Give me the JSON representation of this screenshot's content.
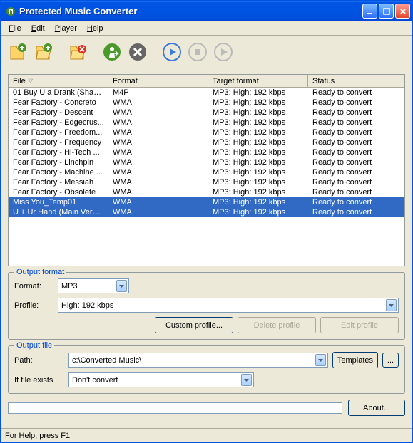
{
  "window": {
    "title": "Protected Music Converter"
  },
  "menu": {
    "file": "File",
    "edit": "Edit",
    "player": "Player",
    "help": "Help"
  },
  "columns": {
    "file": "File",
    "format": "Format",
    "target": "Target format",
    "status": "Status"
  },
  "rows": [
    {
      "file": "01 Buy U a Drank (Shaw...",
      "format": "M4P",
      "target": "MP3: High: 192 kbps",
      "status": "Ready to convert",
      "selected": false
    },
    {
      "file": "Fear Factory - Concreto",
      "format": "WMA",
      "target": "MP3: High: 192 kbps",
      "status": "Ready to convert",
      "selected": false
    },
    {
      "file": "Fear Factory - Descent",
      "format": "WMA",
      "target": "MP3: High: 192 kbps",
      "status": "Ready to convert",
      "selected": false
    },
    {
      "file": "Fear Factory - Edgecrus...",
      "format": "WMA",
      "target": "MP3: High: 192 kbps",
      "status": "Ready to convert",
      "selected": false
    },
    {
      "file": "Fear Factory - Freedom...",
      "format": "WMA",
      "target": "MP3: High: 192 kbps",
      "status": "Ready to convert",
      "selected": false
    },
    {
      "file": "Fear Factory - Frequency",
      "format": "WMA",
      "target": "MP3: High: 192 kbps",
      "status": "Ready to convert",
      "selected": false
    },
    {
      "file": "Fear Factory - Hi-Tech ...",
      "format": "WMA",
      "target": "MP3: High: 192 kbps",
      "status": "Ready to convert",
      "selected": false
    },
    {
      "file": "Fear Factory - Linchpin",
      "format": "WMA",
      "target": "MP3: High: 192 kbps",
      "status": "Ready to convert",
      "selected": false
    },
    {
      "file": "Fear Factory - Machine ...",
      "format": "WMA",
      "target": "MP3: High: 192 kbps",
      "status": "Ready to convert",
      "selected": false
    },
    {
      "file": "Fear Factory - Messiah",
      "format": "WMA",
      "target": "MP3: High: 192 kbps",
      "status": "Ready to convert",
      "selected": false
    },
    {
      "file": "Fear Factory - Obsolete",
      "format": "WMA",
      "target": "MP3: High: 192 kbps",
      "status": "Ready to convert",
      "selected": false
    },
    {
      "file": "Miss You_Temp01",
      "format": "WMA",
      "target": "MP3: High: 192 kbps",
      "status": "Ready to convert",
      "selected": true
    },
    {
      "file": "U + Ur Hand (Main Versi...",
      "format": "WMA",
      "target": "MP3: High: 192 kbps",
      "status": "Ready to convert",
      "selected": true
    }
  ],
  "output_format": {
    "legend": "Output format",
    "format_label": "Format:",
    "format_value": "MP3",
    "profile_label": "Profile:",
    "profile_value": "High: 192 kbps",
    "custom_btn": "Custom profile...",
    "delete_btn": "Delete profile",
    "edit_btn": "Edit profile"
  },
  "output_file": {
    "legend": "Output file",
    "path_label": "Path:",
    "path_value": "c:\\Converted Music\\",
    "templates_btn": "Templates",
    "browse_btn": "...",
    "exists_label": "If file exists",
    "exists_value": "Don't convert"
  },
  "about_btn": "About...",
  "statusbar": "For Help, press F1"
}
